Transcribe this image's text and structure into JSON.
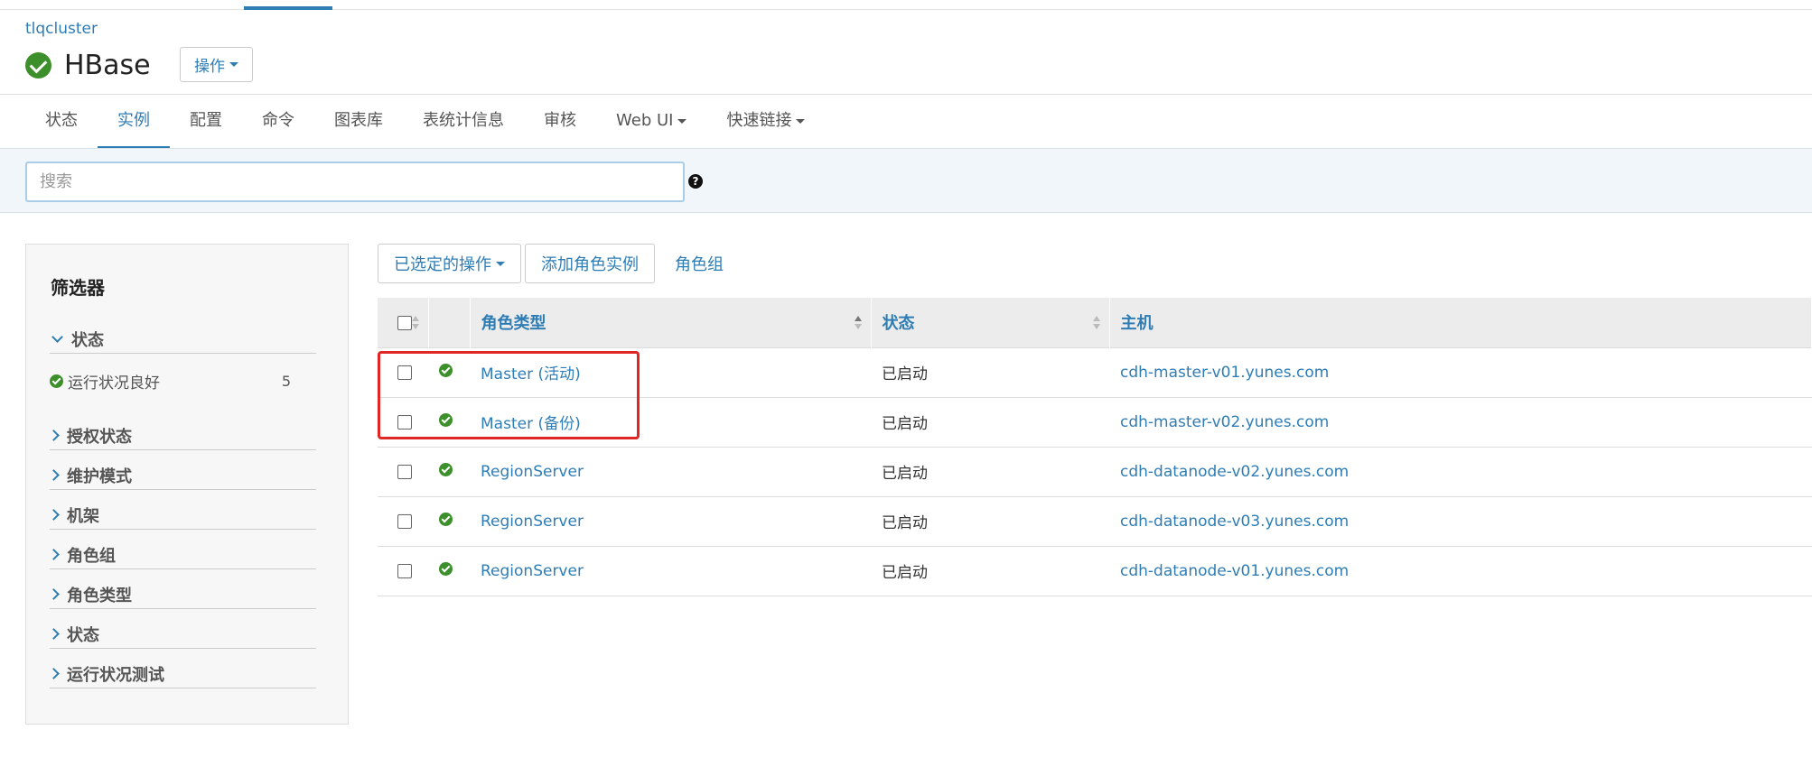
{
  "header": {
    "cluster": "tlqcluster",
    "service": "HBase",
    "actions_label": "操作"
  },
  "tabs": [
    {
      "label": "状态",
      "active": false
    },
    {
      "label": "实例",
      "active": true
    },
    {
      "label": "配置",
      "active": false
    },
    {
      "label": "命令",
      "active": false
    },
    {
      "label": "图表库",
      "active": false
    },
    {
      "label": "表统计信息",
      "active": false
    },
    {
      "label": "审核",
      "active": false
    },
    {
      "label": "Web UI",
      "active": false,
      "dropdown": true
    },
    {
      "label": "快速链接",
      "active": false,
      "dropdown": true
    }
  ],
  "search": {
    "placeholder": "搜索",
    "value": "",
    "help_icon": "question-circle-icon"
  },
  "filters": {
    "title": "筛选器",
    "groups": [
      {
        "label": "状态",
        "expanded": true
      },
      {
        "label": "授权状态"
      },
      {
        "label": "维护模式"
      },
      {
        "label": "机架"
      },
      {
        "label": "角色组"
      },
      {
        "label": "角色类型"
      },
      {
        "label": "状态"
      },
      {
        "label": "运行状况测试"
      }
    ],
    "status_item": {
      "label": "运行状况良好",
      "count": "5"
    }
  },
  "toolbar": {
    "selected_actions": "已选定的操作",
    "add_role_instance": "添加角色实例",
    "role_groups": "角色组"
  },
  "table": {
    "columns": [
      "角色类型",
      "状态",
      "主机"
    ],
    "rows": [
      {
        "role_type": "Master (活动)",
        "status": "已启动",
        "host": "cdh-master-v01.yunes.com"
      },
      {
        "role_type": "Master (备份)",
        "status": "已启动",
        "host": "cdh-master-v02.yunes.com"
      },
      {
        "role_type": "RegionServer",
        "status": "已启动",
        "host": "cdh-datanode-v02.yunes.com"
      },
      {
        "role_type": "RegionServer",
        "status": "已启动",
        "host": "cdh-datanode-v03.yunes.com"
      },
      {
        "role_type": "RegionServer",
        "status": "已启动",
        "host": "cdh-datanode-v01.yunes.com"
      }
    ]
  },
  "colors": {
    "accent": "#2f7db5",
    "health_ok": "#3c8f2a",
    "highlight": "#e12626"
  }
}
